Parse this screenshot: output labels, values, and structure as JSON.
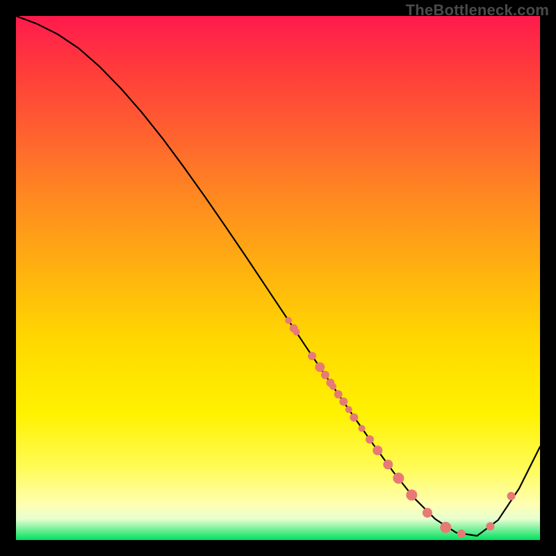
{
  "watermark": "TheBottleneck.com",
  "chart_data": {
    "type": "line",
    "title": "",
    "xlabel": "",
    "ylabel": "",
    "xlim": [
      0,
      100
    ],
    "ylim": [
      0,
      100
    ],
    "curve": {
      "x": [
        0,
        4,
        8,
        12,
        16,
        20,
        24,
        28,
        32,
        36,
        40,
        44,
        48,
        52,
        56,
        60,
        64,
        68,
        72,
        76,
        80,
        84,
        88,
        92,
        96,
        100
      ],
      "y": [
        100,
        98.5,
        96.5,
        93.8,
        90.3,
        86.2,
        81.6,
        76.6,
        71.2,
        65.6,
        59.8,
        53.9,
        47.9,
        41.9,
        35.9,
        30.0,
        24.2,
        18.5,
        13.0,
        8.0,
        4.0,
        1.4,
        0.8,
        3.8,
        9.8,
        17.8
      ]
    },
    "series": [
      {
        "name": "marked-points",
        "x": [
          52.0,
          53.0,
          53.5,
          56.5,
          58.0,
          59.0,
          60.0,
          60.5,
          61.5,
          62.5,
          63.5,
          64.5,
          66.0,
          67.5,
          69.0,
          71.0,
          73.0,
          75.5,
          78.5,
          82.0,
          85.0,
          90.5,
          94.5
        ],
        "y": [
          41.9,
          40.4,
          39.7,
          35.1,
          33.0,
          31.5,
          30.0,
          29.3,
          27.8,
          26.4,
          24.9,
          23.4,
          21.3,
          19.2,
          17.1,
          14.4,
          11.8,
          8.6,
          5.2,
          2.4,
          1.2,
          2.6,
          8.4
        ],
        "r": [
          5,
          6,
          5,
          6,
          7,
          6,
          6,
          5,
          6,
          6,
          5,
          6,
          5,
          6,
          7,
          7,
          8,
          8,
          7,
          8,
          6,
          6,
          6
        ]
      }
    ],
    "colors": {
      "curve": "#000000",
      "dots": "#e77a74"
    }
  }
}
